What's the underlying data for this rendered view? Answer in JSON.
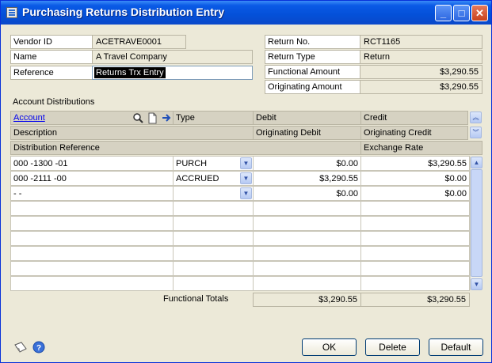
{
  "window": {
    "title": "Purchasing Returns Distribution Entry"
  },
  "header_left": {
    "vendor_id_label": "Vendor ID",
    "vendor_id": "ACETRAVE0001",
    "name_label": "Name",
    "name": "A Travel Company",
    "reference_label": "Reference",
    "reference": "Returns Trx Entry"
  },
  "header_right": {
    "return_no_label": "Return No.",
    "return_no": "RCT1165",
    "return_type_label": "Return Type",
    "return_type": "Return",
    "functional_amount_label": "Functional Amount",
    "functional_amount": "$3,290.55",
    "originating_amount_label": "Originating Amount",
    "originating_amount": "$3,290.55"
  },
  "grid": {
    "section_label": "Account Distributions",
    "col_account": "Account",
    "col_type": "Type",
    "col_debit": "Debit",
    "col_credit": "Credit",
    "col_description": "Description",
    "col_orig_debit": "Originating Debit",
    "col_orig_credit": "Originating Credit",
    "col_dist_ref": "Distribution Reference",
    "col_exchange_rate": "Exchange Rate",
    "rows": [
      {
        "account": "000 -1300 -01",
        "type": "PURCH",
        "debit": "$0.00",
        "credit": "$3,290.55"
      },
      {
        "account": "000 -2111 -00",
        "type": "ACCRUED",
        "debit": "$3,290.55",
        "credit": "$0.00"
      },
      {
        "account": "    -          -",
        "type": "",
        "debit": "$0.00",
        "credit": "$0.00"
      }
    ],
    "totals_label": "Functional Totals",
    "total_debit": "$3,290.55",
    "total_credit": "$3,290.55"
  },
  "buttons": {
    "ok": "OK",
    "delete": "Delete",
    "default": "Default"
  },
  "colors": {
    "titlebar": "#0a5ae6",
    "window_bg": "#ece9d8",
    "link": "#0000ee"
  }
}
